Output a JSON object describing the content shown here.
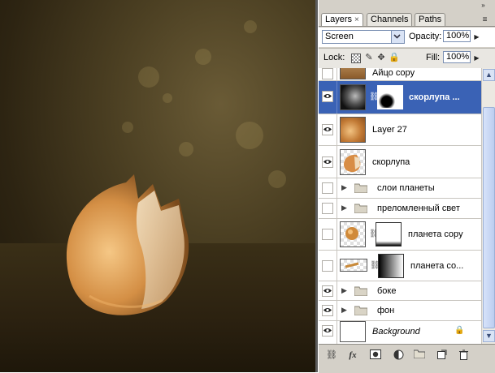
{
  "panel": {
    "tabs": [
      {
        "label": "Layers",
        "active": true,
        "close": "×"
      },
      {
        "label": "Channels",
        "active": false
      },
      {
        "label": "Paths",
        "active": false
      }
    ],
    "blend_mode": "Screen",
    "opacity_label": "Opacity:",
    "opacity_value": "100%",
    "lock_label": "Lock:",
    "fill_label": "Fill:",
    "fill_value": "100%",
    "layers": [
      {
        "name": "Айцо copy",
        "visible": false,
        "type": "layer"
      },
      {
        "name": "скорлупа ...",
        "visible": true,
        "type": "layer",
        "selected": true,
        "mask": true
      },
      {
        "name": "Layer 27",
        "visible": true,
        "type": "layer"
      },
      {
        "name": "скорлупа",
        "visible": true,
        "type": "layer"
      },
      {
        "name": "слои планеты",
        "visible": false,
        "type": "group"
      },
      {
        "name": "преломленный свет",
        "visible": false,
        "type": "group"
      },
      {
        "name": "планета copy",
        "visible": false,
        "type": "layer",
        "mask": true
      },
      {
        "name": "планета со...",
        "visible": false,
        "type": "layer",
        "mask": true
      },
      {
        "name": "боке",
        "visible": true,
        "type": "group"
      },
      {
        "name": "фон",
        "visible": true,
        "type": "group"
      },
      {
        "name": "Background",
        "visible": true,
        "type": "background",
        "locked": true
      }
    ],
    "bottom_icons": [
      "link-icon",
      "fx-icon",
      "mask-icon",
      "adjustment-icon",
      "folder-icon",
      "new-layer-icon",
      "trash-icon"
    ]
  },
  "colors": {
    "selected": "#3a62b5",
    "panel_bg": "#d4d0c8"
  }
}
